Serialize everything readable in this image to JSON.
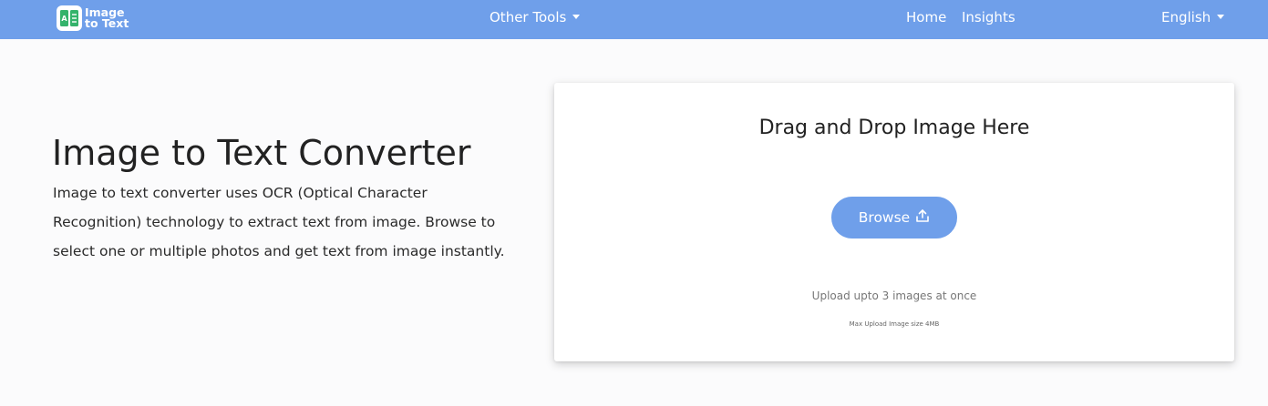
{
  "nav": {
    "logo_line1": "Image",
    "logo_line2": "to Text",
    "other_tools": "Other Tools",
    "home": "Home",
    "insights": "Insights",
    "language": "English"
  },
  "hero": {
    "title": "Image to Text Converter",
    "description": "Image to text converter uses OCR (Optical Character Recognition) technology to extract text from image. Browse to select one or multiple photos and get text from image instantly."
  },
  "upload": {
    "drop_title": "Drag and Drop Image Here",
    "browse_label": "Browse",
    "upload_note": "Upload upto 3 images at once",
    "size_note": "Max Upload Image size 4MB"
  },
  "colors": {
    "accent": "#6f9fea",
    "logo_green": "#34b36b"
  },
  "icons": {
    "logo": "image-to-text-logo-icon",
    "caret": "caret-down-icon",
    "upload": "upload-icon"
  }
}
